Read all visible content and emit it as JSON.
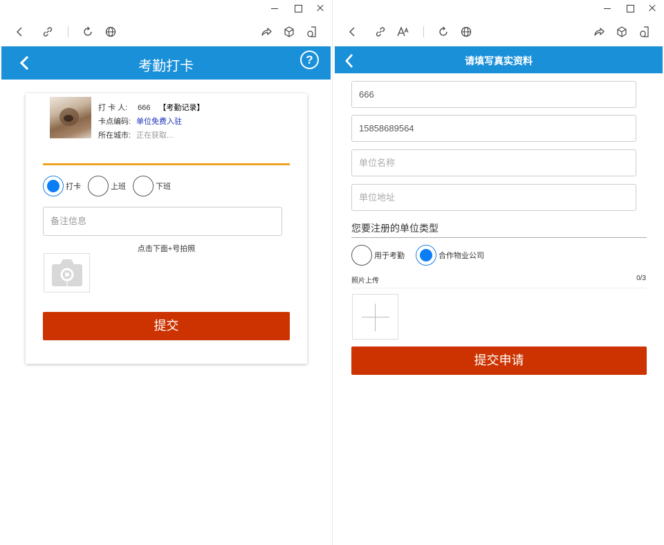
{
  "left": {
    "header": {
      "title": "考勤打卡",
      "help": "?"
    },
    "profile": {
      "checker_label": "打 卡 人:",
      "checker_value": "666",
      "record_link": "【考勤记录】",
      "point_label": "卡点编码:",
      "point_value": "单位免费入驻",
      "city_label": "所在城市:",
      "city_value": "正在获取..."
    },
    "punch_types": [
      {
        "label": "打卡",
        "selected": true
      },
      {
        "label": "上班",
        "selected": false
      },
      {
        "label": "下班",
        "selected": false
      }
    ],
    "note_placeholder": "备注信息",
    "photo_hint": "点击下面+号拍照",
    "submit_label": "提交"
  },
  "right": {
    "header": {
      "title": "请填写真实资料"
    },
    "fields": [
      {
        "value": "666",
        "placeholder": ""
      },
      {
        "value": "15858689564",
        "placeholder": ""
      },
      {
        "value": "",
        "placeholder": "单位名称"
      },
      {
        "value": "",
        "placeholder": "单位地址"
      }
    ],
    "unit_type_title": "您要注册的单位类型",
    "unit_types": [
      {
        "label": "用于考勤",
        "selected": false
      },
      {
        "label": "合作物业公司",
        "selected": true
      }
    ],
    "photo_upload_label": "照片上传",
    "photo_count": "0/3",
    "submit_label": "提交申请"
  },
  "colors": {
    "header_blue": "#1a90d9",
    "submit_red": "#cc3300",
    "accent_orange": "#f0a31e",
    "radio_blue": "#0c7ef5",
    "link_blue": "#1a31b8"
  },
  "icons": {
    "titlebar": [
      "minimize-icon",
      "maximize-icon",
      "close-icon"
    ],
    "toolbar": [
      "back-icon",
      "link-icon",
      "text-size-icon",
      "refresh-icon",
      "globe-icon",
      "share-icon",
      "cube-icon",
      "device-icon"
    ],
    "app": [
      "back-arrow-icon",
      "help-icon",
      "camera-icon",
      "plus-icon"
    ]
  }
}
